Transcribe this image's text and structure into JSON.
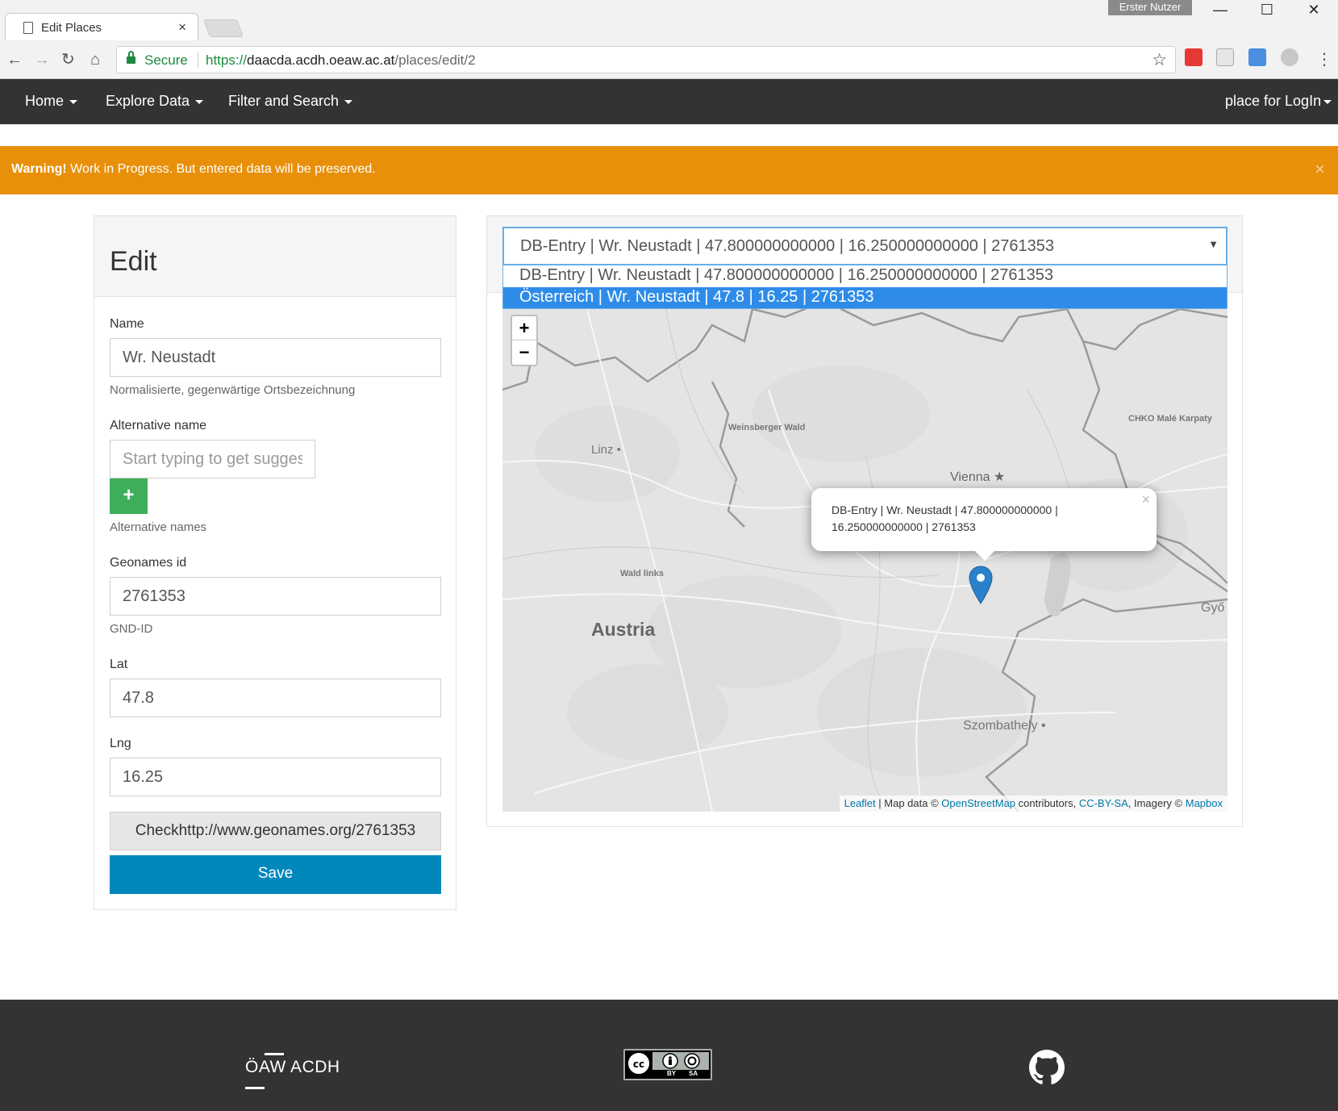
{
  "browser": {
    "tab_title": "Edit Places",
    "tab_close": "×",
    "user_badge": "Erster Nutzer",
    "secure_label": "Secure",
    "url_scheme": "https://",
    "url_host": "daacda.acdh.oeaw.ac.at",
    "url_path": "/places/edit/2",
    "controls": {
      "back": "←",
      "forward": "→",
      "reload": "↻",
      "home": "⌂",
      "star": "☆",
      "menu": "⋮",
      "minimize": "—",
      "maximize": "☐",
      "close": "✕"
    }
  },
  "navbar": {
    "items": [
      {
        "label": "Home"
      },
      {
        "label": "Explore Data"
      },
      {
        "label": "Filter and Search"
      }
    ],
    "login": "place for LogIn"
  },
  "alert": {
    "strong": "Warning!",
    "text": " Work in Progress. But entered data will be preserved.",
    "close": "×"
  },
  "form": {
    "heading": "Edit",
    "name_label": "Name",
    "name_value": "Wr. Neustadt",
    "name_help": "Normalisierte, gegenwärtige Ortsbezeichnung",
    "alt_label": "Alternative name",
    "alt_placeholder": "Start typing to get suggestions",
    "add_button": "+",
    "alt_help": "Alternative names",
    "geonames_label": "Geonames id",
    "geonames_value": "2761353",
    "geonames_help": "GND-ID",
    "lat_label": "Lat",
    "lat_value": "47.8",
    "lng_label": "Lng",
    "lng_value": "16.25",
    "check_button": "Checkhttp://www.geonames.org/2761353",
    "save_button": "Save"
  },
  "map_panel": {
    "select_value": "DB-Entry | Wr. Neustadt | 47.800000000000 | 16.250000000000 | 2761353",
    "select_arrow": "▼",
    "options": [
      "DB-Entry | Wr. Neustadt | 47.800000000000 | 16.250000000000 | 2761353",
      "Österreich | Wr. Neustadt | 47.8 | 16.25 | 2761353"
    ],
    "zoom_in": "+",
    "zoom_out": "−",
    "labels": {
      "linz": "Linz •",
      "weinsberger": "Weinsberger Wald",
      "vienna": "Vienna ★",
      "chko": "CHKO Malé Karpaty",
      "wald_links": "Wald links",
      "austria": "Austria",
      "gyor": "Győ",
      "szombathely": "Szombathely •"
    },
    "popup_text": "DB-Entry | Wr. Neustadt | 47.800000000000 | 16.250000000000 | 2761353",
    "popup_close": "×",
    "attribution": {
      "leaflet": "Leaflet",
      "sep": " | Map data © ",
      "osm": "OpenStreetMap",
      "contributors": " contributors, ",
      "license": "CC-BY-SA",
      "imagery": ", Imagery © ",
      "mapbox": "Mapbox"
    }
  },
  "footer": {
    "logo_text": "ÖAW ACDH",
    "cc_by": "BY",
    "cc_sa": "SA"
  },
  "colors": {
    "navbar": "#333333",
    "alert": "#e8900a",
    "add_button": "#3fae5a",
    "save_button": "#0088bb",
    "dropdown_selected": "#2e8ce8",
    "marker": "#2a81cb"
  }
}
